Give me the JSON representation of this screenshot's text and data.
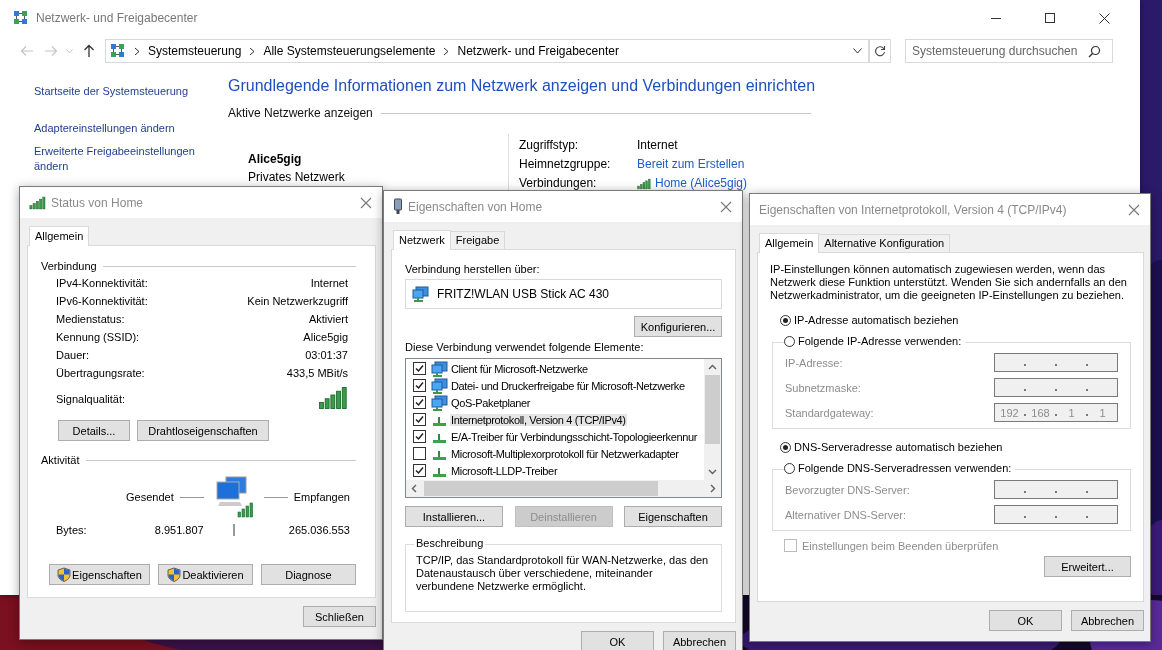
{
  "main_window": {
    "title": "Netzwerk- und Freigabecenter",
    "breadcrumb": [
      "Systemsteuerung",
      "Alle Systemsteuerungselemente",
      "Netzwerk- und Freigabecenter"
    ],
    "search": {
      "placeholder": "Systemsteuerung durchsuchen"
    },
    "sidebar_links": [
      "Startseite der Systemsteuerung",
      "Adaptereinstellungen ändern",
      "Erweiterte Freigabeeinstellungen ändern"
    ],
    "heading": "Grundlegende Informationen zum Netzwerk anzeigen und Verbindungen einrichten",
    "section_title": "Aktive Netzwerke anzeigen",
    "network": {
      "name": "Alice5gig",
      "type": "Privates Netzwerk"
    },
    "details": [
      {
        "label": "Zugriffstyp:",
        "value": "Internet",
        "kind": "text"
      },
      {
        "label": "Heimnetzgruppe:",
        "value": "Bereit zum Erstellen",
        "kind": "link"
      },
      {
        "label": "Verbindungen:",
        "value": "Home (Alice5gig)",
        "kind": "wifi-link"
      }
    ]
  },
  "status_dialog": {
    "title": "Status von Home",
    "tabs": [
      {
        "label": "Allgemein",
        "selected": true
      }
    ],
    "connection": {
      "title": "Verbindung",
      "rows": [
        {
          "label": "IPv4-Konnektivität:",
          "value": "Internet"
        },
        {
          "label": "IPv6-Konnektivität:",
          "value": "Kein Netzwerkzugriff"
        },
        {
          "label": "Medienstatus:",
          "value": "Aktiviert"
        },
        {
          "label": "Kennung (SSID):",
          "value": "Alice5gig"
        },
        {
          "label": "Dauer:",
          "value": "03:01:37"
        },
        {
          "label": "Übertragungsrate:",
          "value": "433,5 MBit/s"
        }
      ],
      "signal_label": "Signalqualität:",
      "buttons": [
        "Details...",
        "Drahtloseigenschaften"
      ]
    },
    "activity": {
      "title": "Aktivität",
      "sent_label": "Gesendet",
      "received_label": "Empfangen",
      "bytes_label": "Bytes:",
      "bytes_sent": "8.951.807",
      "bytes_received": "265.036.553"
    },
    "buttons": [
      {
        "label": "Eigenschaften",
        "shield": true
      },
      {
        "label": "Deaktivieren",
        "shield": true
      },
      {
        "label": "Diagnose",
        "shield": false
      }
    ],
    "close_button": "Schließen"
  },
  "properties_dialog": {
    "title": "Eigenschaften von Home",
    "tabs": [
      {
        "label": "Netzwerk",
        "selected": true
      },
      {
        "label": "Freigabe",
        "selected": false
      }
    ],
    "connect_label": "Verbindung herstellen über:",
    "adapter": "FRITZ!WLAN USB Stick AC 430",
    "configure_button": "Konfigurieren...",
    "elements_label": "Diese Verbindung verwendet folgende Elemente:",
    "elements": [
      {
        "label": "Client für Microsoft-Netzwerke",
        "checked": true,
        "selected": false,
        "kind": "service"
      },
      {
        "label": "Datei- und Druckerfreigabe für Microsoft-Netzwerke",
        "checked": true,
        "selected": false,
        "kind": "service"
      },
      {
        "label": "QoS-Paketplaner",
        "checked": true,
        "selected": false,
        "kind": "service"
      },
      {
        "label": "Internetprotokoll, Version 4 (TCP/IPv4)",
        "checked": true,
        "selected": true,
        "kind": "protocol"
      },
      {
        "label": "E/A-Treiber für Verbindungsschicht-Topologieerkennur",
        "checked": true,
        "selected": false,
        "kind": "protocol"
      },
      {
        "label": "Microsoft-Multiplexorprotokoll für Netzwerkadapter",
        "checked": false,
        "selected": false,
        "kind": "protocol"
      },
      {
        "label": "Microsoft-LLDP-Treiber",
        "checked": true,
        "selected": false,
        "kind": "protocol"
      }
    ],
    "buttons": [
      {
        "label": "Installieren...",
        "disabled": false
      },
      {
        "label": "Deinstallieren",
        "disabled": true
      },
      {
        "label": "Eigenschaften",
        "disabled": false
      }
    ],
    "description": {
      "title": "Beschreibung",
      "text": "TCP/IP, das Standardprotokoll für WAN-Netzwerke, das den Datenaustausch über verschiedene, miteinander verbundene Netzwerke ermöglicht."
    },
    "ok_button": "OK",
    "cancel_button": "Abbrechen"
  },
  "ipv4_dialog": {
    "title": "Eigenschaften von Internetprotokoll, Version 4 (TCP/IPv4)",
    "tabs": [
      {
        "label": "Allgemein",
        "selected": true
      },
      {
        "label": "Alternative Konfiguration",
        "selected": false
      }
    ],
    "intro": "IP-Einstellungen können automatisch zugewiesen werden, wenn das Netzwerk diese Funktion unterstützt. Wenden Sie sich andernfalls an den Netzwerkadministrator, um die geeigneten IP-Einstellungen zu beziehen.",
    "groups": [
      {
        "auto": {
          "label": "IP-Adresse automatisch beziehen",
          "selected": true
        },
        "manual": {
          "label": "Folgende IP-Adresse verwenden:",
          "selected": false
        },
        "fields": [
          {
            "label": "IP-Adresse:"
          },
          {
            "label": "Subnetzmaske:"
          },
          {
            "label": "Standardgateway:",
            "octets": [
              "192",
              "168",
              "1",
              "1"
            ]
          }
        ]
      },
      {
        "auto": {
          "label": "DNS-Serveradresse automatisch beziehen",
          "selected": true
        },
        "manual": {
          "label": "Folgende DNS-Serveradressen verwenden:",
          "selected": false
        },
        "fields": [
          {
            "label": "Bevorzugter DNS-Server:"
          },
          {
            "label": "Alternativer DNS-Server:"
          }
        ]
      }
    ],
    "validate": {
      "label": "Einstellungen beim Beenden überprüfen",
      "checked": false,
      "disabled": true
    },
    "advanced_button": "Erweitert...",
    "ok_button": "OK",
    "cancel_button": "Abbrechen"
  }
}
